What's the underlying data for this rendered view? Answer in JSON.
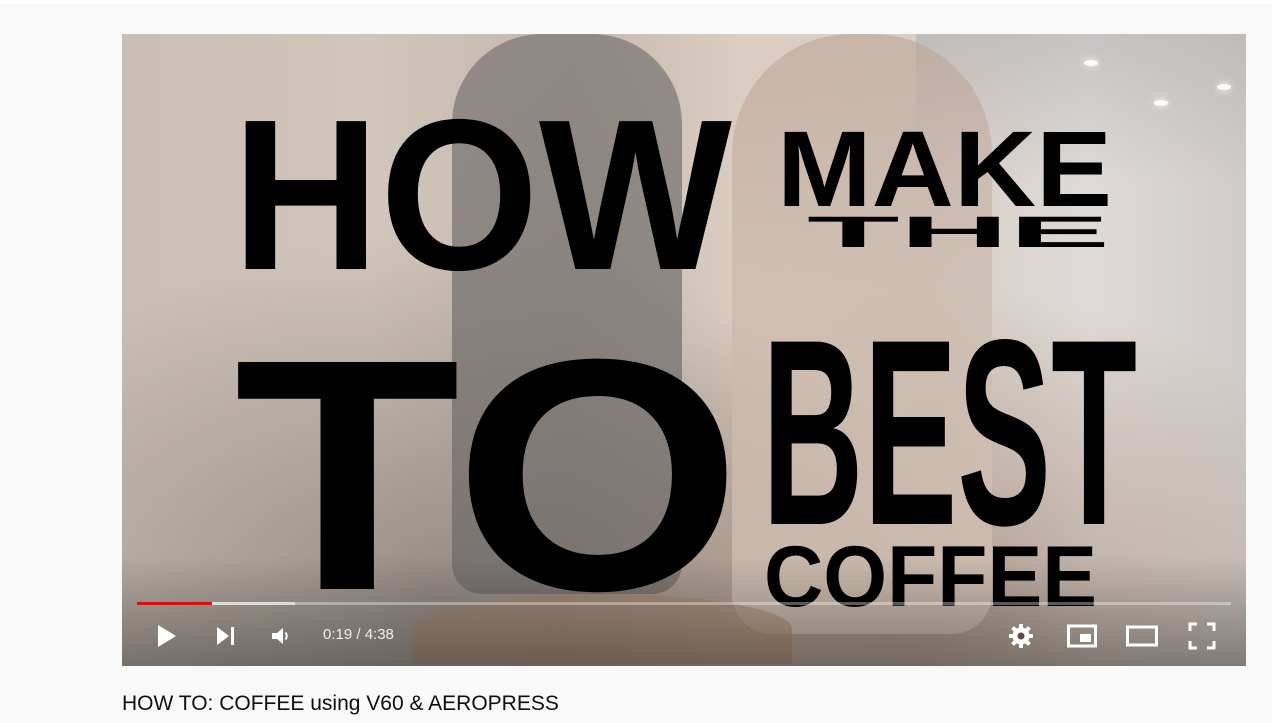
{
  "player": {
    "title_card": {
      "word1": "HOW",
      "word2": "TO",
      "word3": "MAKE",
      "word4": "THE",
      "word5": "BEST",
      "word6": "COFFEE"
    },
    "time_display": "0:19 / 4:38",
    "progress": {
      "played_fraction": 0.069,
      "loaded_fraction": 0.144,
      "played_color": "#ff0000"
    },
    "controls": {
      "left": [
        "play-icon",
        "next-icon",
        "volume-icon"
      ],
      "right": [
        "settings-icon",
        "miniplayer-icon",
        "theater-mode-icon",
        "fullscreen-icon"
      ]
    }
  },
  "video": {
    "title": "HOW TO: COFFEE using V60 & AEROPRESS"
  }
}
